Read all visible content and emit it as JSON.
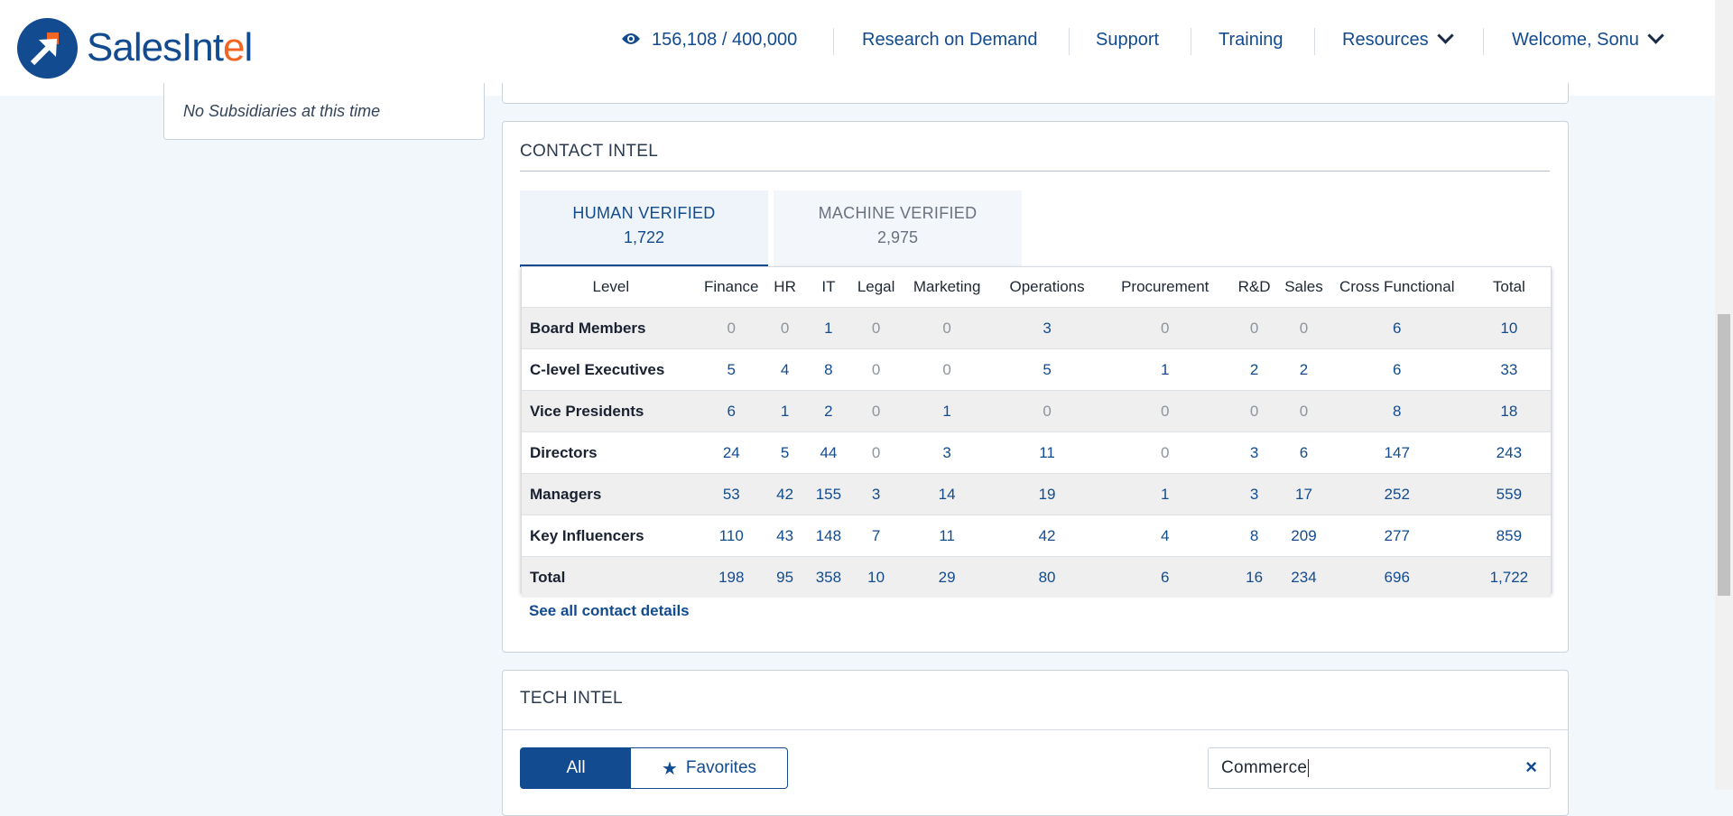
{
  "header": {
    "logo": {
      "text_main": "SalesInt",
      "text_accent": "e",
      "text_end": "l"
    },
    "credits": "156,108 / 400,000",
    "nav": [
      "Research on Demand",
      "Support",
      "Training",
      "Resources",
      "Welcome, Sonu"
    ]
  },
  "left_card": {
    "text": "No Subsidiaries at this time"
  },
  "contact_intel": {
    "title": "CONTACT INTEL",
    "tabs": [
      {
        "label": "HUMAN VERIFIED",
        "count": "1,722"
      },
      {
        "label": "MACHINE VERIFIED",
        "count": "2,975"
      }
    ],
    "columns": [
      "Level",
      "Finance",
      "HR",
      "IT",
      "Legal",
      "Marketing",
      "Operations",
      "Procurement",
      "R&D",
      "Sales",
      "Cross Functional",
      "Total"
    ],
    "rows": [
      [
        "Board Members",
        "0",
        "0",
        "1",
        "0",
        "0",
        "3",
        "0",
        "0",
        "0",
        "6",
        "10"
      ],
      [
        "C-level Executives",
        "5",
        "4",
        "8",
        "0",
        "0",
        "5",
        "1",
        "2",
        "2",
        "6",
        "33"
      ],
      [
        "Vice Presidents",
        "6",
        "1",
        "2",
        "0",
        "1",
        "0",
        "0",
        "0",
        "0",
        "8",
        "18"
      ],
      [
        "Directors",
        "24",
        "5",
        "44",
        "0",
        "3",
        "11",
        "0",
        "3",
        "6",
        "147",
        "243"
      ],
      [
        "Managers",
        "53",
        "42",
        "155",
        "3",
        "14",
        "19",
        "1",
        "3",
        "17",
        "252",
        "559"
      ],
      [
        "Key Influencers",
        "110",
        "43",
        "148",
        "7",
        "11",
        "42",
        "4",
        "8",
        "209",
        "277",
        "859"
      ],
      [
        "Total",
        "198",
        "95",
        "358",
        "10",
        "29",
        "80",
        "6",
        "16",
        "234",
        "696",
        "1,722"
      ]
    ],
    "see_all": "See all contact details"
  },
  "tech_intel": {
    "title": "TECH INTEL",
    "filter_all": "All",
    "filter_favorites": "Favorites",
    "search_value": "Commerce",
    "clear_icon": "×"
  },
  "colors": {
    "primary": "#124b8f",
    "accent": "#f26522",
    "background": "#f2f7fc"
  }
}
